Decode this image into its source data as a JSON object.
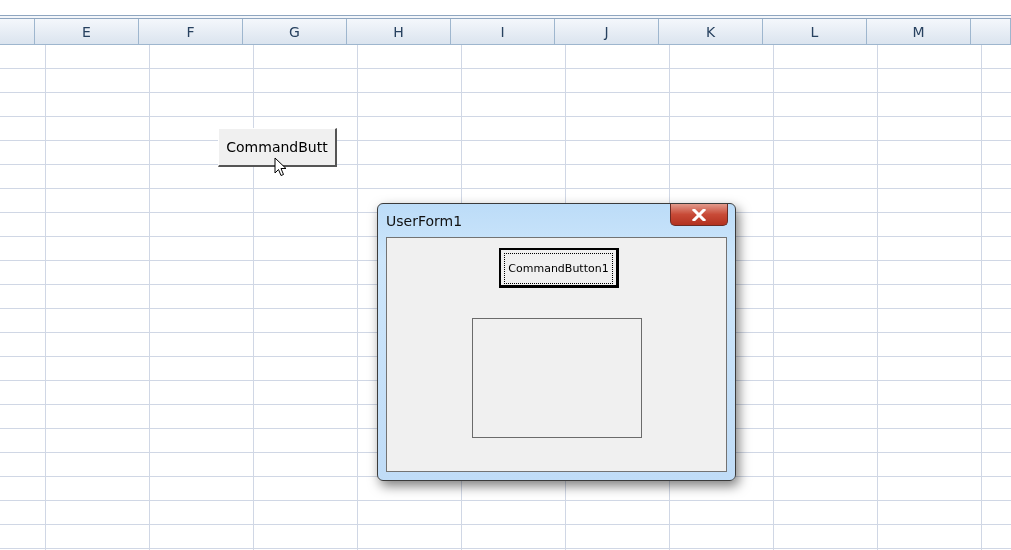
{
  "sheet": {
    "columns": [
      "E",
      "F",
      "G",
      "H",
      "I",
      "J",
      "K",
      "L",
      "M"
    ]
  },
  "sheet_button": {
    "label": "CommandButt"
  },
  "userform": {
    "title": "UserForm1",
    "button": {
      "label": "CommandButton1",
      "focused": true
    }
  }
}
